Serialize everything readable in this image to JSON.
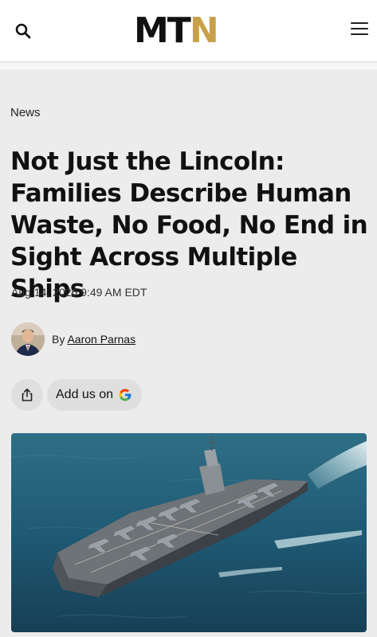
{
  "header": {
    "logo_part1": "MT",
    "logo_part2": "N",
    "search_icon": "search-icon",
    "menu_icon": "hamburger-menu-icon"
  },
  "article": {
    "category": "News",
    "headline": "Not Just the Lincoln: Families Describe Human Waste, No Food, No End in Sight Across Multiple Ships",
    "date": "Aug 14, 2026 9:49 AM EDT",
    "byline_prefix": "By",
    "author": "Aaron Parnas",
    "share_icon": "share-icon",
    "google_button_label": "Add us on",
    "google_icon": "google-g-icon"
  },
  "colors": {
    "logo_dark": "#111111",
    "logo_gold": "#c9a04a",
    "page_bg": "#ececec",
    "button_bg": "#dfdfdf"
  }
}
